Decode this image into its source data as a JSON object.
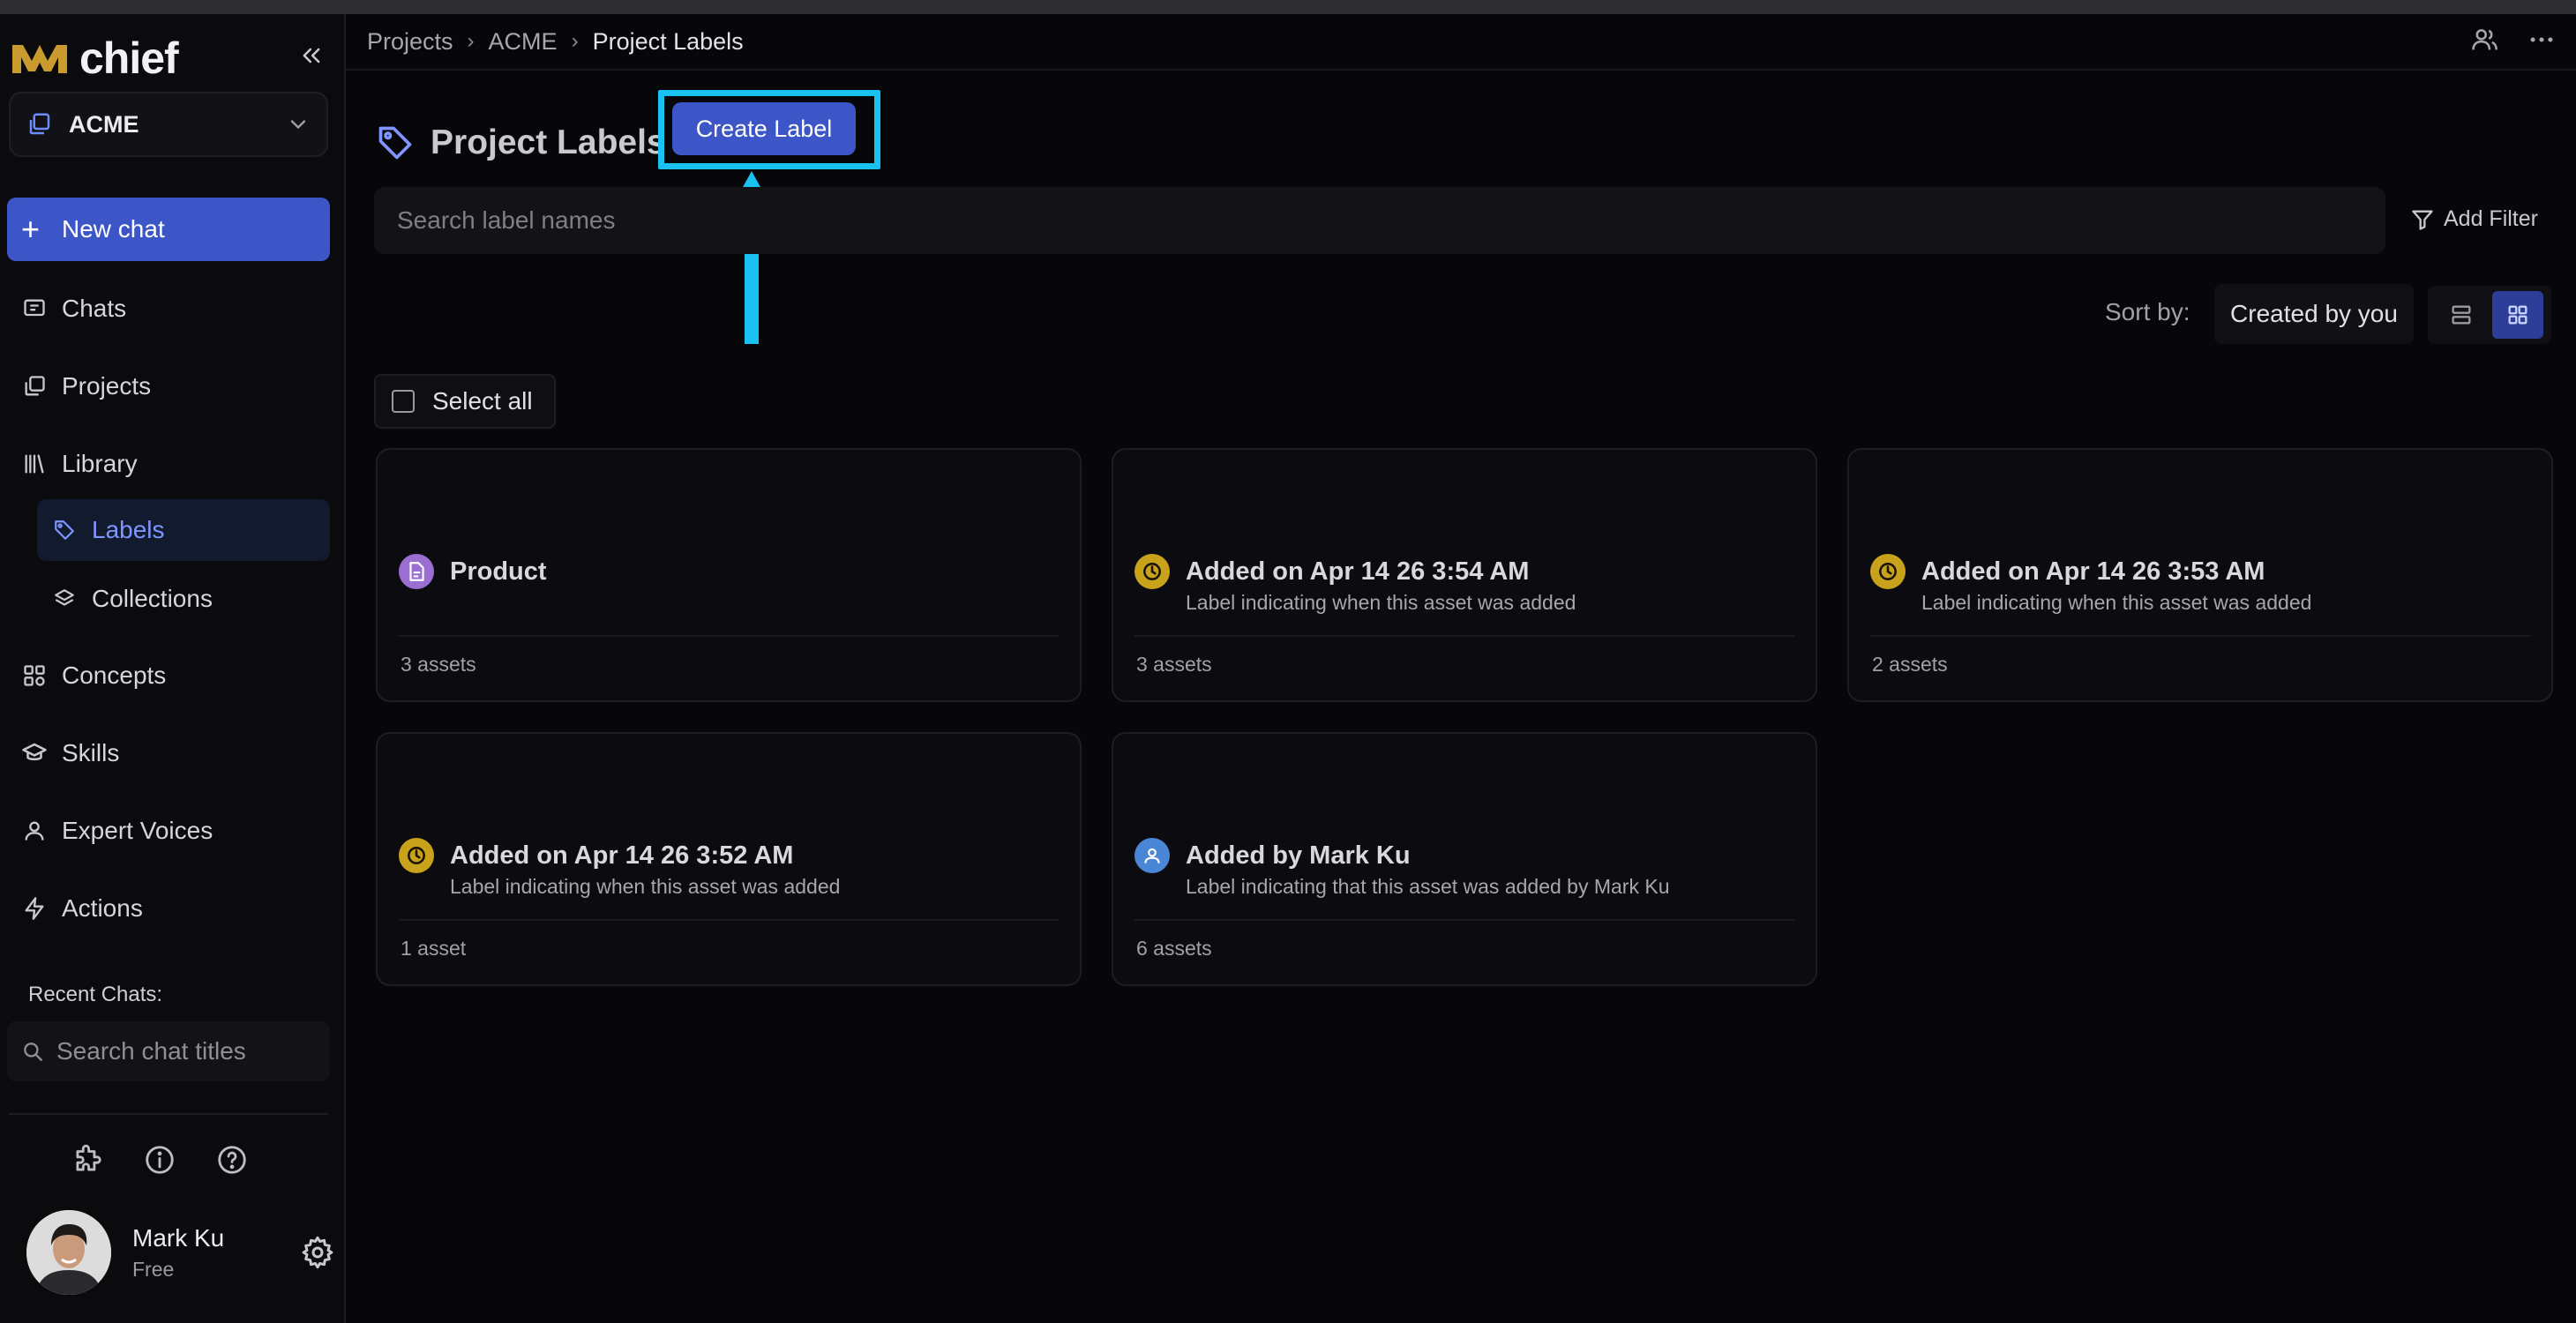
{
  "brand": {
    "name": "chief"
  },
  "workspace": {
    "name": "ACME"
  },
  "sidebar": {
    "new_chat": "New chat",
    "items": [
      {
        "label": "Chats",
        "icon": "chat-icon"
      },
      {
        "label": "Projects",
        "icon": "projects-icon"
      },
      {
        "label": "Library",
        "icon": "library-icon"
      },
      {
        "label": "Labels",
        "icon": "tag-icon",
        "active": true
      },
      {
        "label": "Collections",
        "icon": "layers-icon"
      },
      {
        "label": "Concepts",
        "icon": "concepts-icon"
      },
      {
        "label": "Skills",
        "icon": "graduation-cap-icon"
      },
      {
        "label": "Expert Voices",
        "icon": "person-icon"
      },
      {
        "label": "Actions",
        "icon": "lightning-icon"
      }
    ],
    "recent_label": "Recent Chats:",
    "chat_search_placeholder": "Search chat titles",
    "footer_icons": [
      "puzzle-icon",
      "info-icon",
      "help-icon"
    ]
  },
  "user": {
    "name": "Mark Ku",
    "plan": "Free"
  },
  "breadcrumb": [
    "Projects",
    "ACME",
    "Project Labels"
  ],
  "page": {
    "title": "Project Labels",
    "create_button": "Create Label",
    "search_placeholder": "Search label names",
    "add_filter": "Add Filter",
    "sort_label": "Sort by:",
    "sort_value": "Created by you",
    "select_all": "Select all"
  },
  "colors": {
    "accent": "#3c55c7",
    "highlight": "#19c2f0",
    "clock_badge": "#c9a21b",
    "doc_badge": "#9b6fd1",
    "person_badge": "#4a86d6"
  },
  "cards": [
    {
      "title": "Product",
      "description": "",
      "count": "3 assets",
      "icon": "document-icon"
    },
    {
      "title": "Added on Apr 14 26 3:54 AM",
      "description": "Label indicating when this asset was added",
      "count": "3 assets",
      "icon": "clock-icon"
    },
    {
      "title": "Added on Apr 14 26 3:53 AM",
      "description": "Label indicating when this asset was added",
      "count": "2 assets",
      "icon": "clock-icon"
    },
    {
      "title": "Added on Apr 14 26 3:52 AM",
      "description": "Label indicating when this asset was added",
      "count": "1 asset",
      "icon": "clock-icon"
    },
    {
      "title": "Added by Mark Ku",
      "description": "Label indicating that this asset was added by Mark Ku",
      "count": "6 assets",
      "icon": "person-icon"
    }
  ]
}
